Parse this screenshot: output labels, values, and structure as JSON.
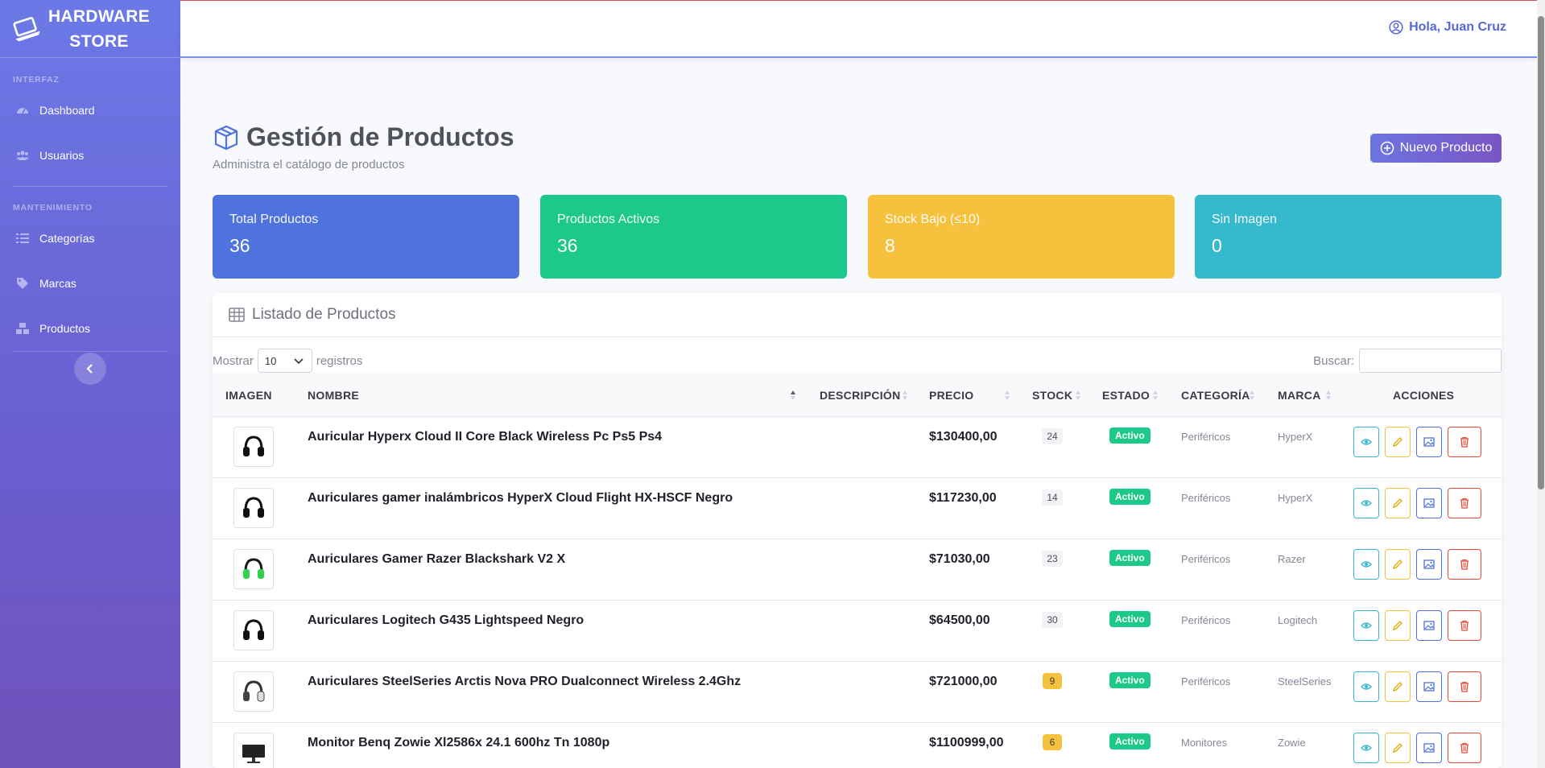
{
  "sidebar": {
    "brand": "HARDWARE STORE",
    "brand_line1": "HARDWARE",
    "brand_line2": "STORE",
    "heading_interfaz": "INTERFAZ",
    "heading_mantenimiento": "MANTENIMIENTO",
    "items": [
      {
        "label": "Dashboard",
        "icon": "dashboard-icon"
      },
      {
        "label": "Usuarios",
        "icon": "users-icon"
      },
      {
        "label": "Categorías",
        "icon": "list-icon"
      },
      {
        "label": "Marcas",
        "icon": "tag-icon"
      },
      {
        "label": "Productos",
        "icon": "boxes-icon"
      }
    ]
  },
  "topbar": {
    "user_greeting": "Hola, Juan Cruz"
  },
  "header": {
    "title": "Gestión de Productos",
    "subtitle": "Administra el catálogo de productos",
    "new_button": "Nuevo Producto"
  },
  "stats": [
    {
      "label": "Total Productos",
      "value": "36",
      "color": "#4e73df"
    },
    {
      "label": "Productos Activos",
      "value": "36",
      "color": "#1cc88a"
    },
    {
      "label": "Stock Bajo (≤10)",
      "value": "8",
      "color": "#f6c23e"
    },
    {
      "label": "Sin Imagen",
      "value": "0",
      "color": "#36b9cc"
    }
  ],
  "table": {
    "title": "Listado de Productos",
    "show_label": "Mostrar",
    "page_size": "10",
    "records_label": "registros",
    "search_label": "Buscar:",
    "columns": [
      "IMAGEN",
      "NOMBRE",
      "DESCRIPCIÓN",
      "PRECIO",
      "STOCK",
      "ESTADO",
      "CATEGORÍA",
      "MARCA",
      "ACCIONES"
    ],
    "rows": [
      {
        "name": "Auricular Hyperx Cloud II Core Black Wireless Pc Ps5 Ps4",
        "price": "$130400,00",
        "stock": "24",
        "low": false,
        "status": "Activo",
        "category": "Periféricos",
        "brand": "HyperX",
        "img": "headset-black"
      },
      {
        "name": "Auriculares gamer inalámbricos HyperX Cloud Flight HX-HSCF Negro",
        "price": "$117230,00",
        "stock": "14",
        "low": false,
        "status": "Activo",
        "category": "Periféricos",
        "brand": "HyperX",
        "img": "headset-black"
      },
      {
        "name": "Auriculares Gamer Razer Blackshark V2 X",
        "price": "$71030,00",
        "stock": "23",
        "low": false,
        "status": "Activo",
        "category": "Periféricos",
        "brand": "Razer",
        "img": "headset-green"
      },
      {
        "name": "Auriculares Logitech G435 Lightspeed Negro",
        "price": "$64500,00",
        "stock": "30",
        "low": false,
        "status": "Activo",
        "category": "Periféricos",
        "brand": "Logitech",
        "img": "headset-black"
      },
      {
        "name": "Auriculares SteelSeries Arctis Nova PRO Dualconnect Wireless 2.4Ghz",
        "price": "$721000,00",
        "stock": "9",
        "low": true,
        "status": "Activo",
        "category": "Periféricos",
        "brand": "SteelSeries",
        "img": "headset-white"
      },
      {
        "name": "Monitor Benq Zowie Xl2586x 24.1 600hz Tn 1080p",
        "price": "$1100999,00",
        "stock": "6",
        "low": true,
        "status": "Activo",
        "category": "Monitores",
        "brand": "Zowie",
        "img": "monitor"
      }
    ]
  }
}
